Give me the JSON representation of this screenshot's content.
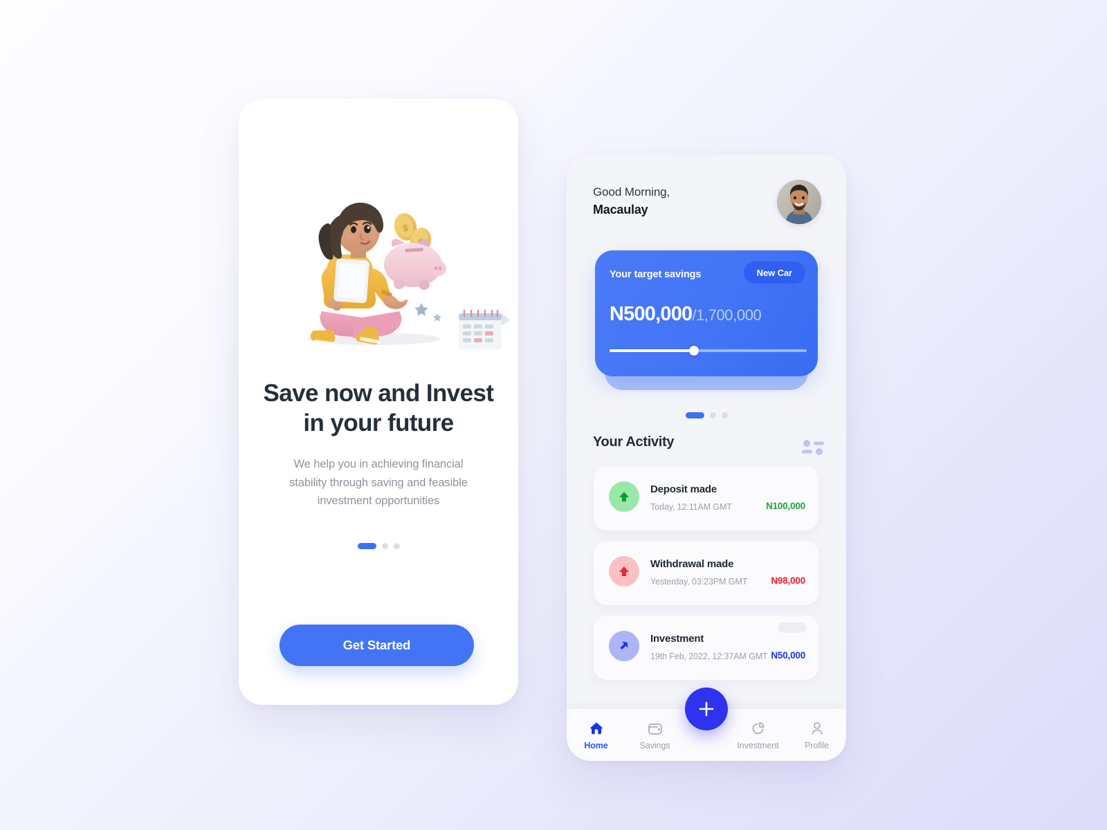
{
  "theme": {
    "bg_start": "#fdfdff",
    "bg_end": "#dcdcfa",
    "accent_blue": "#4274f5",
    "fab_blue": "#2f32ee",
    "green": "#14a83a",
    "red": "#ef1b2a",
    "blue_amount": "#1631ee"
  },
  "onboarding": {
    "illustration_name": "woman-saving-piggy-bank-illustration",
    "headline": "Save now and Invest in your future",
    "subcopy": "We help you in achieving financial stability through saving and feasible investment opportunities",
    "pagination": {
      "total": 3,
      "active_index": 0
    },
    "cta_label": "Get Started"
  },
  "dashboard": {
    "greeting": "Good Morning,",
    "user_name": "Macaulay",
    "avatar_name": "user-avatar-photo",
    "savings_card": {
      "label": "Your target savings",
      "badge": "New Car",
      "current_amount": "N500,000",
      "target_amount": "/1,700,000",
      "progress_percent": 43
    },
    "card_pagination": {
      "total": 3,
      "active_index": 0
    },
    "activity": {
      "title": "Your Activity",
      "filter_icon": "filter-sliders-icon",
      "rows": [
        {
          "icon": "arrow-up-deposit-icon",
          "title": "Deposit made",
          "time": "Today, 12:11AM GMT",
          "amount": "N100,000",
          "amount_color": "green"
        },
        {
          "icon": "arrow-up-withdrawal-icon",
          "title": "Withdrawal made",
          "time": "Yesterday, 03:23PM GMT",
          "amount": "N98,000",
          "amount_color": "red"
        },
        {
          "icon": "arrow-diagonal-investment-icon",
          "title": "Investment",
          "time": "19th Feb, 2022,  12:37AM GMT",
          "amount": "N50,000",
          "amount_color": "blue"
        }
      ]
    },
    "fab": {
      "icon": "plus-icon",
      "label": "+"
    },
    "nav": [
      {
        "icon": "home-icon",
        "label": "Home",
        "active": true
      },
      {
        "icon": "wallet-icon",
        "label": "Savings",
        "active": false
      },
      {
        "icon": "pie-chart-icon",
        "label": "Investment",
        "active": false
      },
      {
        "icon": "person-icon",
        "label": "Profile",
        "active": false
      }
    ]
  }
}
